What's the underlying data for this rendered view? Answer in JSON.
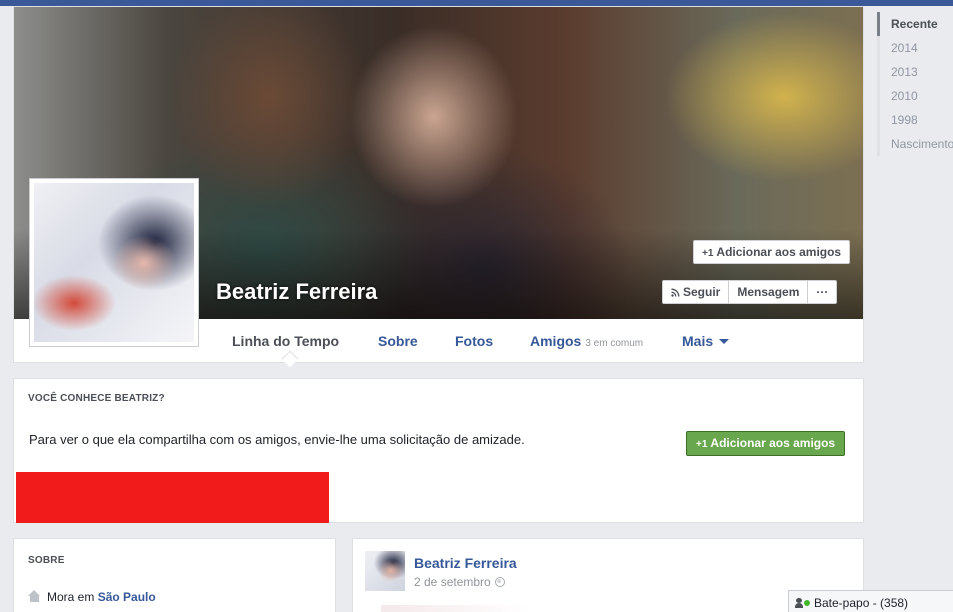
{
  "profile": {
    "name": "Beatriz Ferreira"
  },
  "cover_actions": {
    "add_friend": "Adicionar aos amigos",
    "follow": "Seguir",
    "message": "Mensagem",
    "more": "···"
  },
  "tabs": [
    {
      "label": "Linha do Tempo"
    },
    {
      "label": "Sobre"
    },
    {
      "label": "Fotos"
    },
    {
      "label": "Amigos",
      "sub": "3 em comum"
    },
    {
      "label": "Mais"
    }
  ],
  "timeline_nav": [
    "Recente",
    "2014",
    "2013",
    "2010",
    "1998",
    "Nascimento"
  ],
  "know_card": {
    "heading": "VOCÊ CONHECE BEATRIZ?",
    "text": "Para ver o que ela compartilha com os amigos, envie-lhe uma solicitação de amizade.",
    "button": "Adicionar aos amigos"
  },
  "about_card": {
    "heading": "SOBRE",
    "lives_prefix": "Mora em",
    "city": "São Paulo"
  },
  "post": {
    "author": "Beatriz Ferreira",
    "date": "2 de setembro"
  },
  "chat": {
    "label": "Bate-papo - (358)"
  },
  "icons": {
    "add_friend": "+1",
    "follow": "rss-icon",
    "more_tab": "caret-down-icon",
    "about": "home-icon",
    "privacy": "globe-icon",
    "chat": "person-icon"
  },
  "colors": {
    "brand": "#3b5998",
    "link": "#365899",
    "green_button": "#69a74e",
    "redaction": "#f21b1b"
  }
}
